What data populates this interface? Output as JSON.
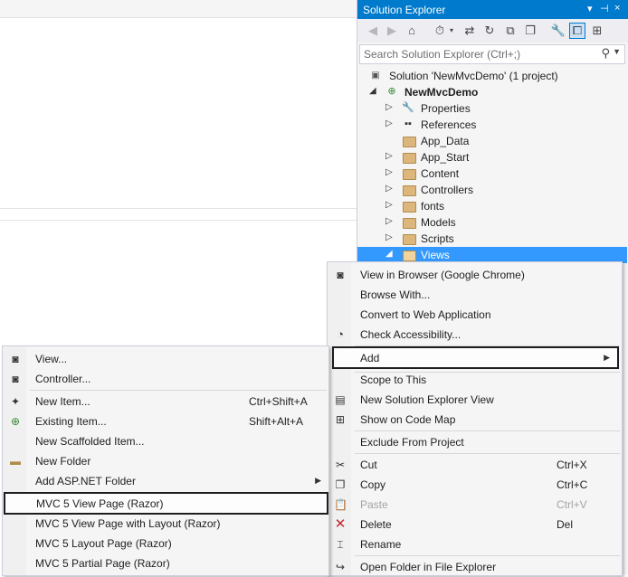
{
  "solution_explorer": {
    "title": "Solution Explorer",
    "title_controls": [
      "▾",
      "⊣",
      "×"
    ],
    "search_placeholder": "Search Solution Explorer (Ctrl+;)",
    "solution_label": "Solution 'NewMvcDemo' (1 project)",
    "project_label": "NewMvcDemo",
    "items": [
      {
        "label": "Properties",
        "icon": "wrench-icon",
        "expandable": true
      },
      {
        "label": "References",
        "icon": "references-icon",
        "expandable": true
      },
      {
        "label": "App_Data",
        "icon": "folder-icon",
        "expandable": false
      },
      {
        "label": "App_Start",
        "icon": "folder-icon",
        "expandable": true
      },
      {
        "label": "Content",
        "icon": "folder-icon",
        "expandable": true
      },
      {
        "label": "Controllers",
        "icon": "folder-icon",
        "expandable": true
      },
      {
        "label": "fonts",
        "icon": "folder-icon",
        "expandable": true
      },
      {
        "label": "Models",
        "icon": "folder-icon",
        "expandable": true
      },
      {
        "label": "Scripts",
        "icon": "folder-icon",
        "expandable": true
      },
      {
        "label": "Views",
        "icon": "folder-open-icon",
        "expandable": true,
        "selected": true
      }
    ]
  },
  "context_menu": {
    "items": [
      {
        "label": "View in Browser (Google Chrome)",
        "shortcut": "",
        "icon": "browser-icon"
      },
      {
        "label": "Browse With...",
        "shortcut": "",
        "icon": ""
      },
      {
        "label": "Convert to Web Application",
        "shortcut": "",
        "icon": ""
      },
      {
        "label": "Check Accessibility...",
        "shortcut": "",
        "icon": "accessibility-icon"
      },
      {
        "label": "Add",
        "shortcut": "",
        "icon": "",
        "submenu": true,
        "highlighted": true
      },
      {
        "label": "Scope to This",
        "shortcut": "",
        "icon": ""
      },
      {
        "label": "New Solution Explorer View",
        "shortcut": "",
        "icon": "new-view-icon"
      },
      {
        "label": "Show on Code Map",
        "shortcut": "",
        "icon": "code-map-icon"
      },
      {
        "label": "Exclude From Project",
        "shortcut": "",
        "icon": ""
      },
      {
        "label": "Cut",
        "shortcut": "Ctrl+X",
        "icon": "cut-icon"
      },
      {
        "label": "Copy",
        "shortcut": "Ctrl+C",
        "icon": "copy-icon"
      },
      {
        "label": "Paste",
        "shortcut": "Ctrl+V",
        "icon": "paste-icon",
        "disabled": true
      },
      {
        "label": "Delete",
        "shortcut": "Del",
        "icon": "delete-icon"
      },
      {
        "label": "Rename",
        "shortcut": "",
        "icon": "rename-icon"
      },
      {
        "label": "Open Folder in File Explorer",
        "shortcut": "",
        "icon": "open-folder-icon"
      }
    ]
  },
  "add_submenu": {
    "items": [
      {
        "label": "View...",
        "shortcut": "",
        "icon": "view-icon"
      },
      {
        "label": "Controller...",
        "shortcut": "",
        "icon": "controller-icon"
      },
      {
        "label": "New Item...",
        "shortcut": "Ctrl+Shift+A",
        "icon": "new-item-icon"
      },
      {
        "label": "Existing Item...",
        "shortcut": "Shift+Alt+A",
        "icon": "existing-item-icon"
      },
      {
        "label": "New Scaffolded Item...",
        "shortcut": "",
        "icon": ""
      },
      {
        "label": "New Folder",
        "shortcut": "",
        "icon": "new-folder-icon"
      },
      {
        "label": "Add ASP.NET Folder",
        "shortcut": "",
        "icon": "",
        "submenu": true
      },
      {
        "label": "MVC 5 View Page (Razor)",
        "shortcut": "",
        "icon": "",
        "highlighted": true
      },
      {
        "label": "MVC 5 View Page with Layout (Razor)",
        "shortcut": "",
        "icon": ""
      },
      {
        "label": "MVC 5 Layout Page (Razor)",
        "shortcut": "",
        "icon": ""
      },
      {
        "label": "MVC 5 Partial Page (Razor)",
        "shortcut": "",
        "icon": ""
      }
    ]
  },
  "colors": {
    "accent": "#007acc",
    "selection": "#3399ff",
    "menu_bg": "#f5f5f5"
  }
}
